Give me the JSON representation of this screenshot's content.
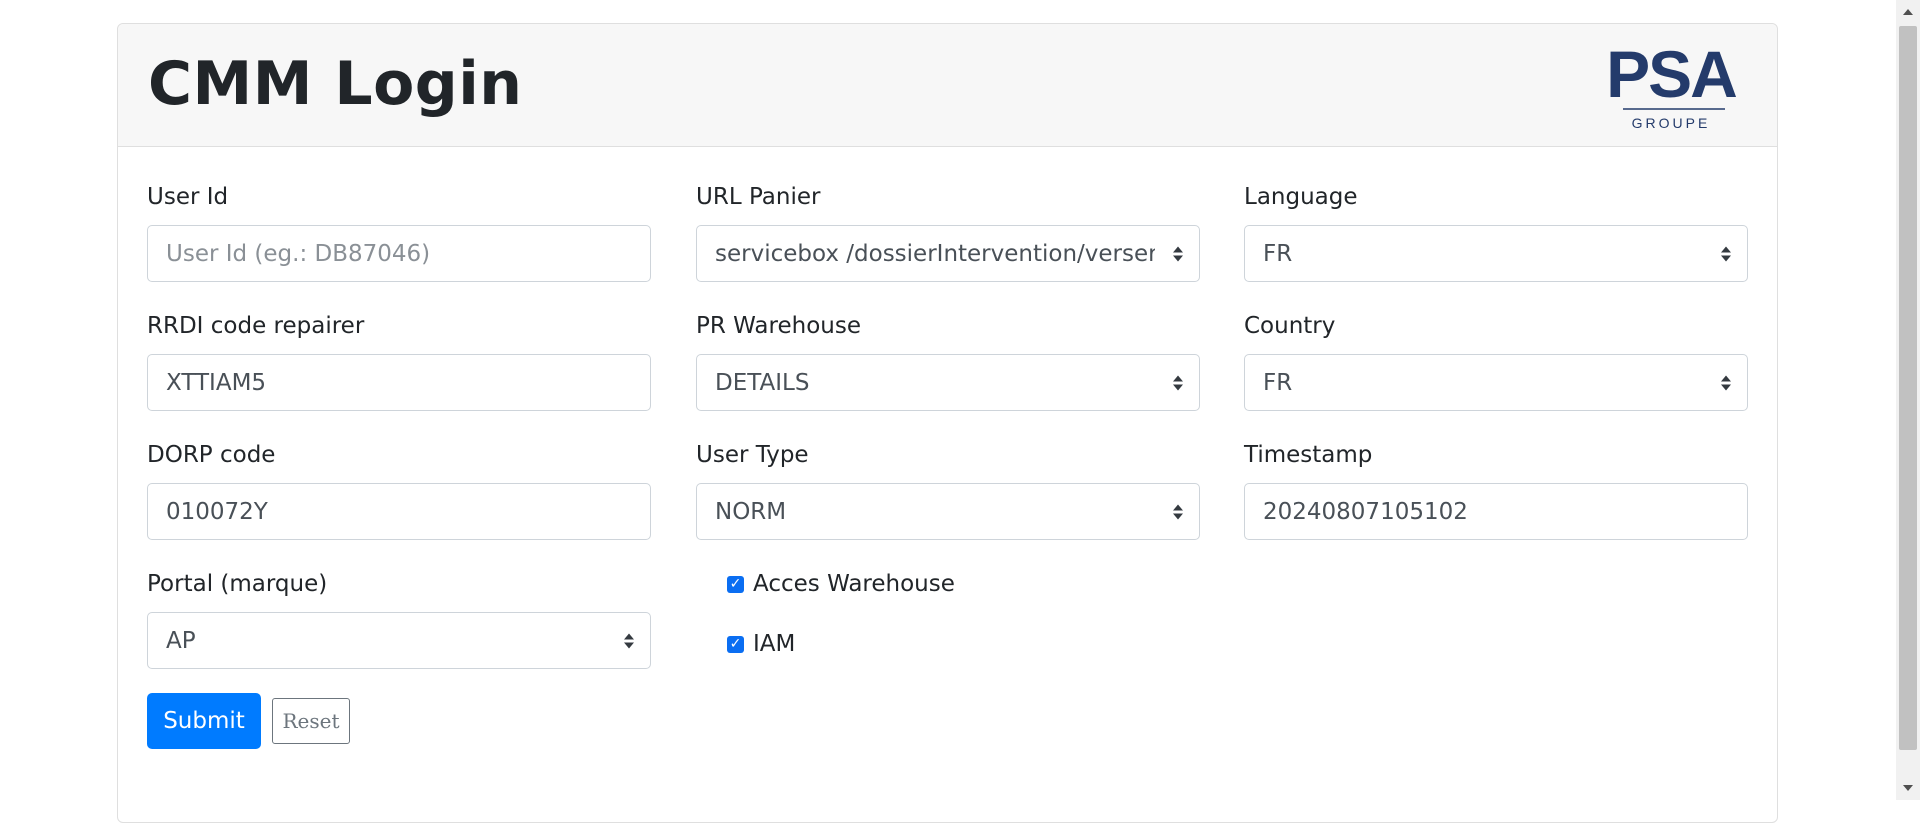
{
  "header": {
    "title": "CMM Login",
    "logo_text": "PSA",
    "logo_subtext": "GROUPE"
  },
  "fields": {
    "user_id": {
      "label": "User Id",
      "placeholder": "User Id (eg.: DB87046)",
      "value": ""
    },
    "url_panier": {
      "label": "URL Panier",
      "value": "servicebox /dossierIntervention/verserItem"
    },
    "language": {
      "label": "Language",
      "value": "FR"
    },
    "rrdi": {
      "label": "RRDI code repairer",
      "value": "XTTIAM5"
    },
    "pr_warehouse": {
      "label": "PR Warehouse",
      "value": "DETAILS"
    },
    "country": {
      "label": "Country",
      "value": "FR"
    },
    "dorp": {
      "label": "DORP code",
      "value": "010072Y"
    },
    "user_type": {
      "label": "User Type",
      "value": "NORM"
    },
    "timestamp": {
      "label": "Timestamp",
      "value": "20240807105102"
    },
    "portal": {
      "label": "Portal (marque)",
      "value": "AP"
    }
  },
  "checkboxes": {
    "acces_warehouse": {
      "label": "Acces Warehouse",
      "checked": true
    },
    "iam": {
      "label": "IAM",
      "checked": true
    }
  },
  "buttons": {
    "submit": "Submit",
    "reset": "Reset"
  },
  "colors": {
    "primary": "#007bff",
    "logo": "#243b6b",
    "header_bg": "#f7f7f7"
  }
}
